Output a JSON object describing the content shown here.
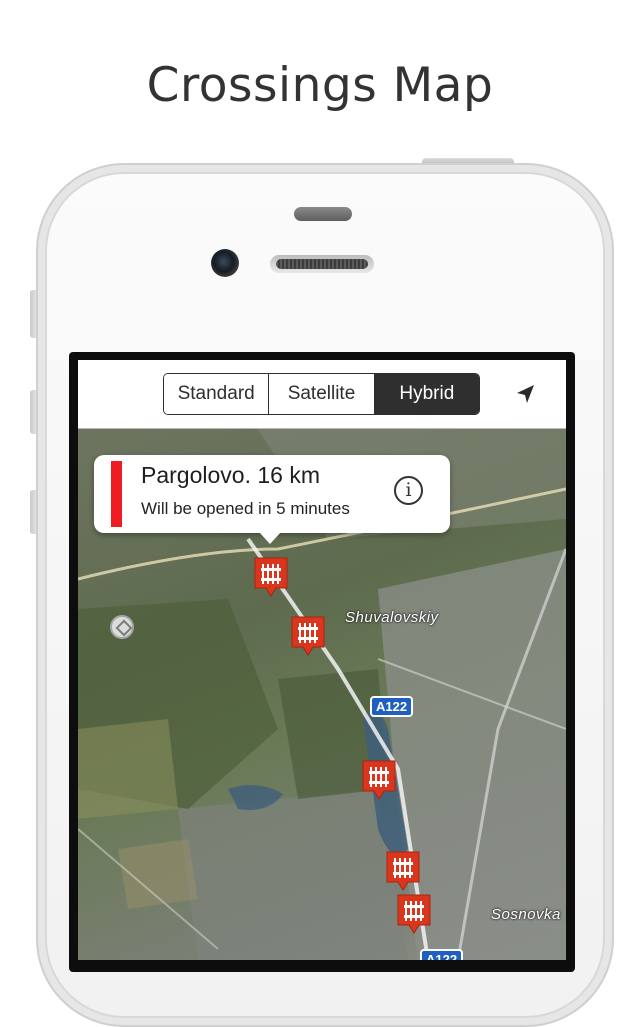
{
  "headline": "Crossings Map",
  "toolbar": {
    "map_types": [
      "Standard",
      "Satellite",
      "Hybrid"
    ],
    "selected_map_type": "Hybrid",
    "locate_icon": "location-arrow-icon"
  },
  "callout": {
    "title": "Pargolovo. 16 km",
    "subtitle": "Will be opened in 5 minutes",
    "status_color": "#ee1d23",
    "info_glyph": "i"
  },
  "map": {
    "place_labels": [
      "Shuvalovskiy",
      "Sosnovka"
    ],
    "road_shields": [
      "A122",
      "A122"
    ],
    "marker_icon": "railway-crossing-icon",
    "marker_color": "#d9361d",
    "marker_count": 5
  }
}
